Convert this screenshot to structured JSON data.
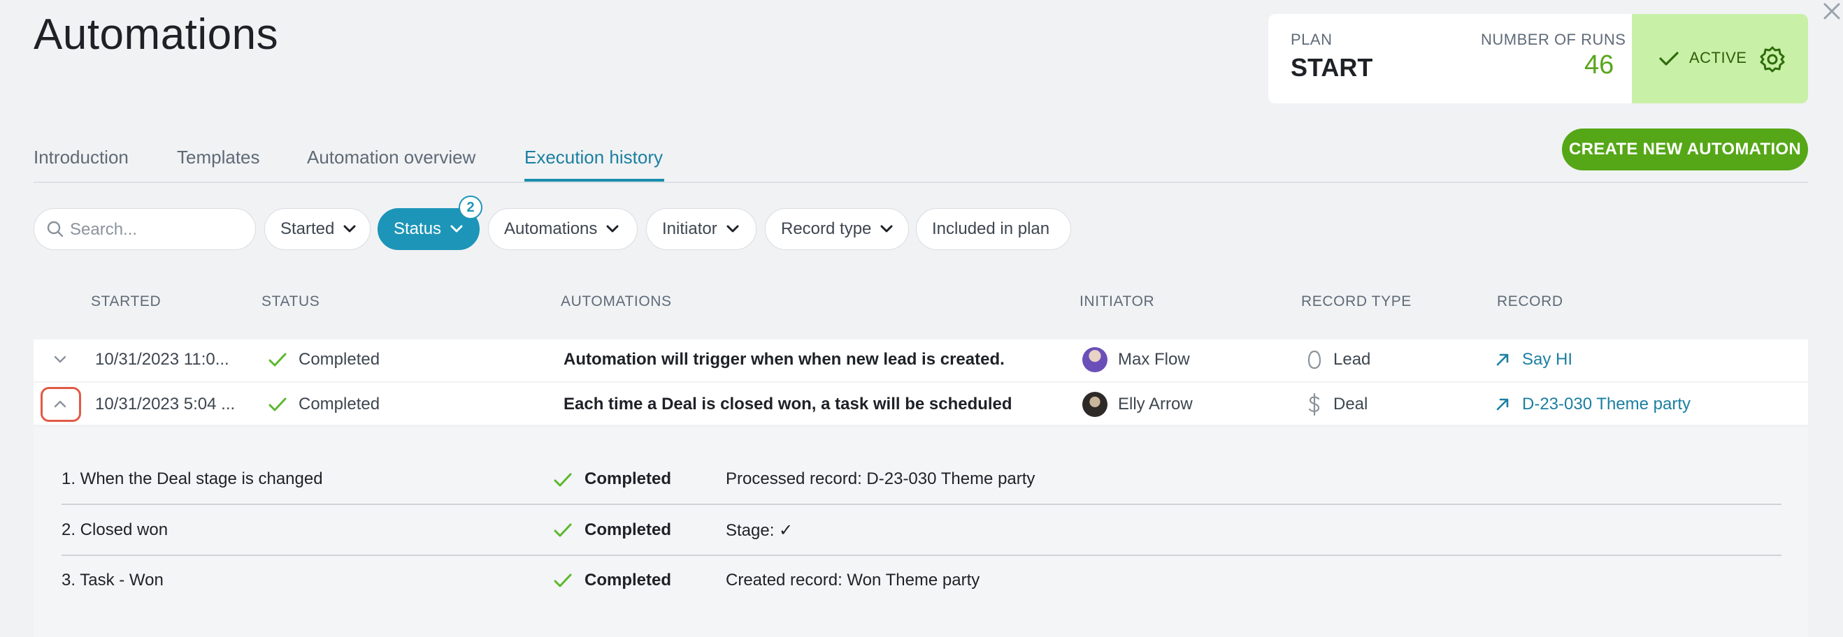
{
  "page": {
    "title": "Automations"
  },
  "plan_card": {
    "plan_label": "PLAN",
    "plan_value": "START",
    "runs_label": "NUMBER OF RUNS",
    "runs_value": "46",
    "status_label": "ACTIVE"
  },
  "tabs": [
    {
      "label": "Introduction"
    },
    {
      "label": "Templates"
    },
    {
      "label": "Automation overview"
    },
    {
      "label": "Execution history",
      "active": true
    }
  ],
  "create_button": {
    "label": "CREATE NEW AUTOMATION"
  },
  "search": {
    "placeholder": "Search...",
    "value": ""
  },
  "filters": {
    "started": "Started",
    "status": "Status",
    "status_count": "2",
    "automations": "Automations",
    "initiator": "Initiator",
    "record_type": "Record type",
    "included_in_plan": "Included in plan"
  },
  "table": {
    "columns": [
      "STARTED",
      "STATUS",
      "AUTOMATIONS",
      "INITIATOR",
      "RECORD TYPE",
      "RECORD"
    ],
    "rows": [
      {
        "started": "10/31/2023 11:0...",
        "status": "Completed",
        "automation": "Automation will trigger when when new lead is created.",
        "initiator": "Max Flow",
        "record_type": "Lead",
        "record": "Say HI"
      },
      {
        "started": "10/31/2023 5:04 ...",
        "status": "Completed",
        "automation": "Each time a Deal is closed won, a task will be scheduled",
        "initiator": "Elly Arrow",
        "record_type": "Deal",
        "record": "D-23-030 Theme party"
      }
    ]
  },
  "details": {
    "steps": [
      {
        "name": "1. When the Deal stage is changed",
        "status": "Completed",
        "info": "Processed record: D-23-030 Theme party"
      },
      {
        "name": "2. Closed won",
        "status": "Completed",
        "info": "Stage: ✓"
      },
      {
        "name": "3. Task - Won",
        "status": "Completed",
        "info": "Created record: Won Theme party"
      }
    ]
  },
  "colors": {
    "accent_teal": "#1d95b8",
    "brand_green": "#55a717",
    "active_bg": "#c8f0a6",
    "check_green": "#5cb82e",
    "highlight_red": "#e15a45"
  },
  "icons": {
    "close": "close-icon",
    "check": "check-icon",
    "gear": "gear-icon",
    "search": "search-icon",
    "chevron_down": "chevron-down-icon",
    "chevron_up": "chevron-up-icon",
    "lead": "lead-icon",
    "deal": "dollar-icon",
    "record_link": "arrow-up-right-icon"
  }
}
